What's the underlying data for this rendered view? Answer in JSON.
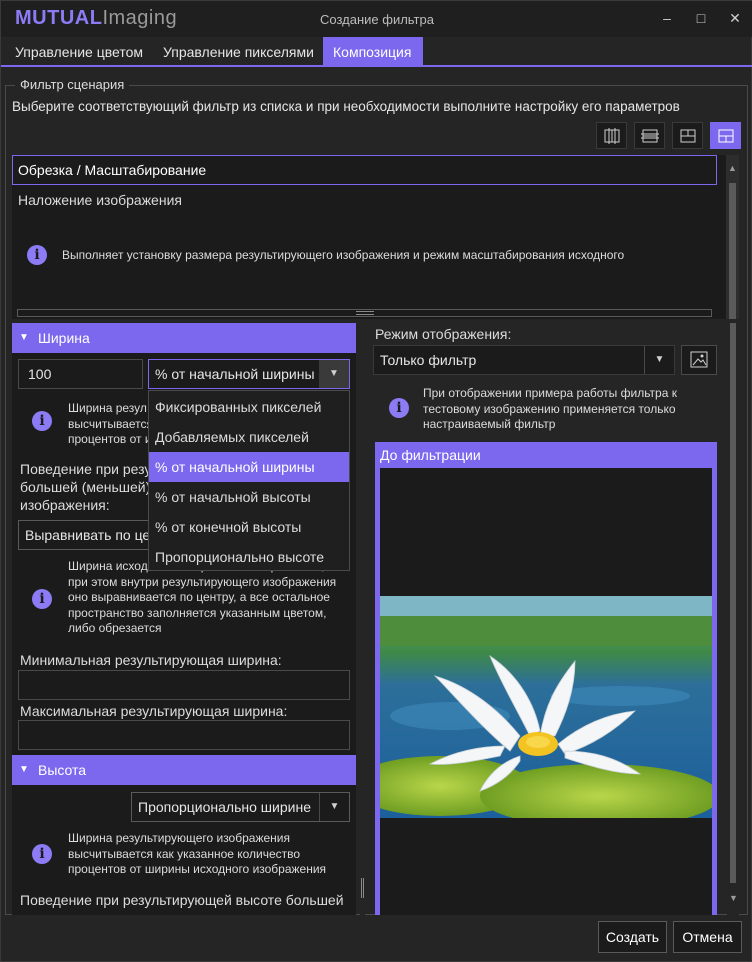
{
  "app": {
    "logo_bold": "MUTUAL",
    "logo_light": "Imaging",
    "window_title": "Создание фильтра"
  },
  "tabs": [
    {
      "label": "Управление цветом",
      "active": false
    },
    {
      "label": "Управление пикселями",
      "active": false
    },
    {
      "label": "Композиция",
      "active": true
    }
  ],
  "group": {
    "legend": "Фильтр сценария",
    "hint": "Выберите соответствующий фильтр из списка и при необходимости выполните настройку его параметров"
  },
  "filter_list": {
    "selected": "Обрезка / Масштабирование",
    "items": [
      "Наложение изображения"
    ],
    "info": "Выполняет установку размера результирующего изображения и режим масштабирования исходного"
  },
  "width_section": {
    "title": "Ширина",
    "value": "100",
    "unit_selected": "% от начальной ширины",
    "info_partial": [
      "Ширина резул",
      "высчитывается",
      "процентов от и"
    ],
    "behavior_label_partial": [
      "Поведение при резу",
      "большей (меньшей)",
      "изображения:"
    ],
    "behavior_value_partial": "Выравнивать по це",
    "behavior_info": [
      "Ширина исходного изображения сохраняется,",
      "при этом внутри результирующего изображения",
      "оно выравнивается по центру, а все остальное",
      "пространство заполняется указанным цветом,",
      "либо обрезается"
    ],
    "min_label": "Минимальная результирующая ширина:",
    "min_value": "",
    "max_label": "Максимальная результирующая ширина:",
    "max_value": ""
  },
  "unit_dropdown": {
    "options": [
      "Фиксированных пикселей",
      "Добавляемых пикселей",
      "% от начальной ширины",
      "% от начальной высоты",
      "% от конечной высоты",
      "Пропорционально высоте"
    ],
    "highlighted": "% от начальной ширины"
  },
  "height_section": {
    "title": "Высота",
    "mode": "Пропорционально ширине",
    "info": [
      "Ширина результирующего изображения",
      "высчитывается как указанное количество",
      "процентов от ширины исходного изображения"
    ],
    "behavior_label": "Поведение при результирующей высоте большей"
  },
  "display": {
    "label": "Режим отображения:",
    "mode": "Только фильтр",
    "info": [
      "При отображении примера работы фильтра к",
      "тестовому изображению применяется только",
      "настраиваемый фильтр"
    ],
    "preview_header": "До фильтрации"
  },
  "footer": {
    "create": "Создать",
    "cancel": "Отмена"
  },
  "colors": {
    "accent": "#7b68ee",
    "background": "#252526",
    "panel": "#1b1b1b"
  }
}
